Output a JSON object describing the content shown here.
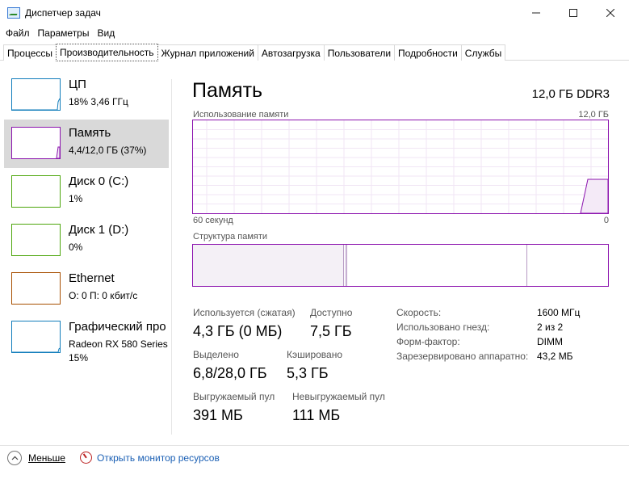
{
  "window": {
    "title": "Диспетчер задач",
    "minimize_icon": "minimize-icon",
    "maximize_icon": "maximize-icon",
    "close_icon": "close-icon"
  },
  "menu": [
    "Файл",
    "Параметры",
    "Вид"
  ],
  "tabs": [
    "Процессы",
    "Производительность",
    "Журнал приложений",
    "Автозагрузка",
    "Пользователи",
    "Подробности",
    "Службы"
  ],
  "active_tab": "Производительность",
  "sidebar": {
    "items": [
      {
        "name": "ЦП",
        "sub": "18% 3,46 ГГц",
        "color": "#117dbb"
      },
      {
        "name": "Память",
        "sub": "4,4/12,0 ГБ (37%)",
        "color": "#8b12ae"
      },
      {
        "name": "Диск 0 (C:)",
        "sub": "1%",
        "color": "#4da60c"
      },
      {
        "name": "Диск 1 (D:)",
        "sub": "0%",
        "color": "#4da60c"
      },
      {
        "name": "Ethernet",
        "sub": "О: 0 П: 0 кбит/с",
        "color": "#a74f01"
      },
      {
        "name": "Графический про",
        "sub": "Radeon RX 580 Series",
        "sub2": "15%",
        "color": "#117dbb"
      }
    ]
  },
  "main": {
    "title": "Память",
    "spec": "12,0 ГБ DDR3",
    "usage_label": "Использование памяти",
    "usage_max": "12,0 ГБ",
    "time_label": "60 секунд",
    "time_zero": "0",
    "composition_label": "Структура памяти",
    "accent_color": "#8b12ae"
  },
  "stats": {
    "in_use_label": "Используется (сжатая)",
    "in_use_value": "4,3 ГБ (0 МБ)",
    "available_label": "Доступно",
    "available_value": "7,5 ГБ",
    "committed_label": "Выделено",
    "committed_value": "6,8/28,0 ГБ",
    "cached_label": "Кэшировано",
    "cached_value": "5,3 ГБ",
    "paged_label": "Выгружаемый пул",
    "paged_value": "391 МБ",
    "nonpaged_label": "Невыгружаемый пул",
    "nonpaged_value": "111 МБ"
  },
  "specs": {
    "speed_label": "Скорость:",
    "speed_value": "1600 МГц",
    "slots_label": "Использовано гнезд:",
    "slots_value": "2 из 2",
    "form_label": "Форм-фактор:",
    "form_value": "DIMM",
    "reserved_label": "Зарезервировано аппаратно:",
    "reserved_value": "43,2 МБ"
  },
  "footer": {
    "fewer_label": "Меньше",
    "fewer_icon": "chevron-up-icon",
    "resmon_label": "Открыть монитор ресурсов",
    "resmon_icon": "resource-monitor-icon"
  }
}
